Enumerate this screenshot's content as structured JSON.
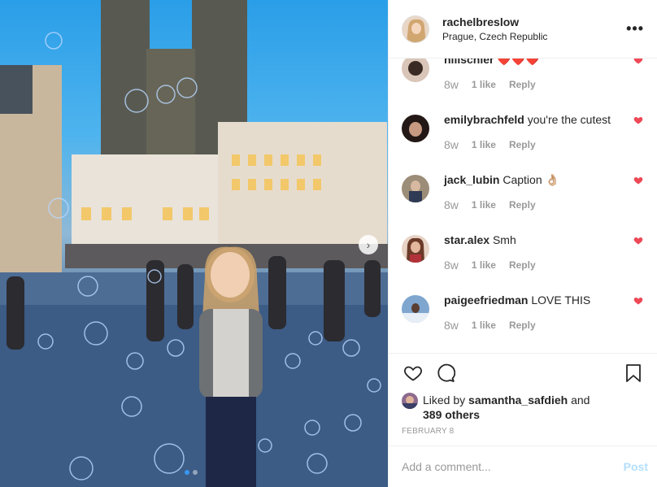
{
  "post": {
    "username": "rachelbreslow",
    "location": "Prague, Czech Republic",
    "more_icon": "more-horizontal-icon",
    "photo": {
      "description_icon": "photo-old-town-square",
      "next_icon": "chevron-right-icon",
      "carousel_total": 2,
      "carousel_active": 1
    }
  },
  "comments": [
    {
      "username": "nilischler",
      "text": "❤️❤️❤️",
      "time": "8w",
      "likes": "1 like",
      "reply": "Reply",
      "avatar_color": "#c9b2a4"
    },
    {
      "username": "emilybrachfeld",
      "text": "you're the cutest",
      "time": "8w",
      "likes": "1 like",
      "reply": "Reply",
      "avatar_color": "#3b2a25"
    },
    {
      "username": "jack_lubin",
      "text": "Caption 👌🏼",
      "time": "8w",
      "likes": "1 like",
      "reply": "Reply",
      "avatar_color": "#8a7a68"
    },
    {
      "username": "star.alex",
      "text": "Smh",
      "time": "8w",
      "likes": "1 like",
      "reply": "Reply",
      "avatar_color": "#a8563f"
    },
    {
      "username": "paigeefriedman",
      "text": "LOVE THIS",
      "time": "8w",
      "likes": "1 like",
      "reply": "Reply",
      "avatar_color": "#6d8fb5"
    }
  ],
  "actions": {
    "like_icon": "heart-outline-icon",
    "comment_icon": "comment-bubble-icon",
    "save_icon": "bookmark-icon"
  },
  "likes_summary": {
    "prefix": "Liked by ",
    "user": "samantha_safdieh",
    "middle": " and",
    "others": "389 others"
  },
  "date": "FEBRUARY 8",
  "add_comment": {
    "placeholder": "Add a comment...",
    "post_label": "Post"
  },
  "colors": {
    "heart_red": "#ed4956",
    "post_disabled": "#b2dffc",
    "carousel_dot_active": "#3897f0"
  }
}
